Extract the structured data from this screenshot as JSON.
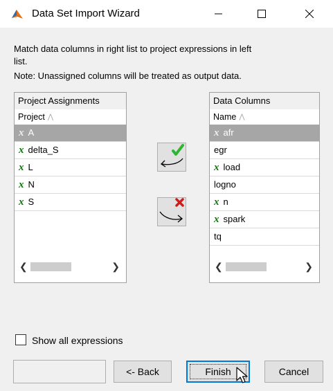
{
  "window": {
    "title": "Data Set Import Wizard",
    "controls": {
      "minimize_icon": "minimize-icon",
      "maximize_icon": "maximize-icon",
      "close_icon": "close-icon"
    }
  },
  "instructions": {
    "line1": "Match data columns in right list to project expressions in left",
    "line2": "list.",
    "line3": "Note: Unassigned columns will be treated as output data."
  },
  "left_panel": {
    "title": "Project Assignments",
    "column_header": "Project",
    "rows": [
      {
        "label": "A",
        "icon": "expression-x-icon",
        "selected": true
      },
      {
        "label": "delta_S",
        "icon": "expression-x-icon",
        "selected": false
      },
      {
        "label": "L",
        "icon": "expression-x-icon",
        "selected": false
      },
      {
        "label": "N",
        "icon": "expression-x-icon",
        "selected": false
      },
      {
        "label": "S",
        "icon": "expression-x-icon",
        "selected": false
      }
    ]
  },
  "right_panel": {
    "title": "Data Columns",
    "column_header": "Name",
    "rows": [
      {
        "label": "afr",
        "icon": "expression-x-icon",
        "selected": true
      },
      {
        "label": "egr",
        "icon": "",
        "selected": false
      },
      {
        "label": "load",
        "icon": "expression-x-icon",
        "selected": false
      },
      {
        "label": "logno",
        "icon": "",
        "selected": false
      },
      {
        "label": "n",
        "icon": "expression-x-icon",
        "selected": false
      },
      {
        "label": "spark",
        "icon": "expression-x-icon",
        "selected": false
      },
      {
        "label": "tq",
        "icon": "",
        "selected": false
      }
    ]
  },
  "assign_buttons": {
    "assign_icon": "assign-checkmark-arrow-icon",
    "unassign_icon": "unassign-x-arrow-icon"
  },
  "options": {
    "show_all_expressions_label": "Show all expressions",
    "show_all_expressions_checked": false
  },
  "buttons": {
    "back": "<- Back",
    "finish": "Finish",
    "cancel": "Cancel"
  },
  "colors": {
    "selection": "#a6a6a6",
    "focus_border": "#0078d7",
    "expression_icon": "#0a7a0a",
    "check_green": "#2fb52f",
    "x_red": "#d61a1a"
  }
}
